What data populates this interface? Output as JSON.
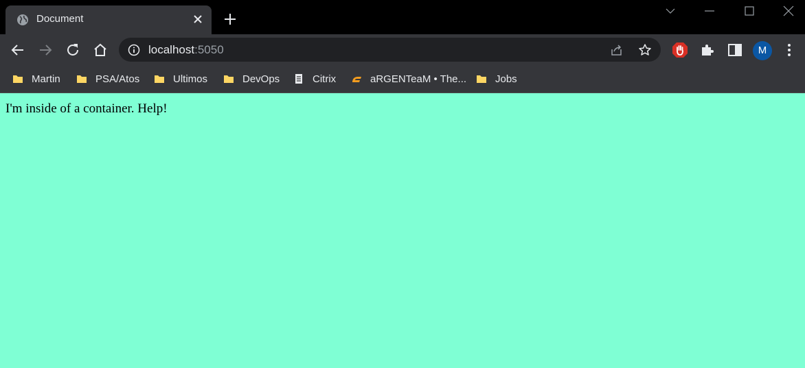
{
  "tab": {
    "title": "Document"
  },
  "address_bar": {
    "host": "localhost",
    "port": ":5050"
  },
  "profile": {
    "initial": "M"
  },
  "bookmarks": [
    {
      "label": "Martin",
      "icon": "folder-icon"
    },
    {
      "label": "PSA/Atos",
      "icon": "folder-icon"
    },
    {
      "label": "Ultimos",
      "icon": "folder-icon"
    },
    {
      "label": "DevOps",
      "icon": "folder-icon"
    },
    {
      "label": "Citrix",
      "icon": "document-icon"
    },
    {
      "label": "aRGENTeaM • The...",
      "icon": "argenteam-icon"
    },
    {
      "label": "Jobs",
      "icon": "folder-icon"
    }
  ],
  "page": {
    "text": "I'm inside of a container. Help!"
  },
  "colors": {
    "page_background": "#7fffd4",
    "chrome_dark": "#35363a",
    "folder": "#fdd663",
    "adblock": "#d93025",
    "avatar": "#0b57a4"
  }
}
